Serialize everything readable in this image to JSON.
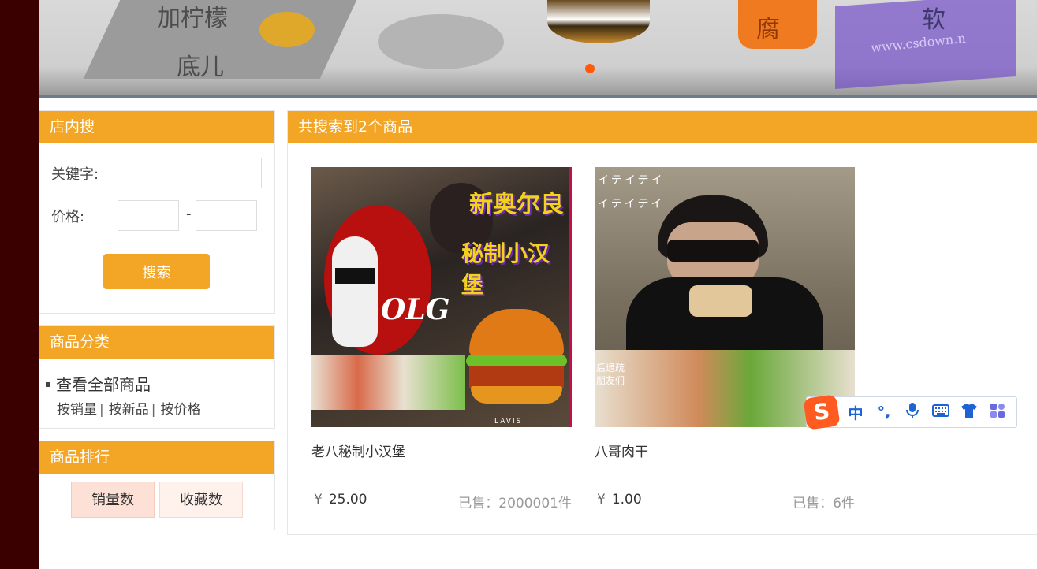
{
  "banner": {
    "texts": [
      "加柠檬",
      "底儿",
      "腐",
      "软"
    ],
    "watermark": "www.csdown.n",
    "active_dot_color": "#ff5a0d"
  },
  "search_panel": {
    "title": "店内搜",
    "keyword_label": "关键字:",
    "keyword_value": "",
    "price_label": "价格:",
    "price_min_value": "",
    "price_max_value": "",
    "price_separator": "-",
    "search_button": "搜索"
  },
  "category_panel": {
    "title": "商品分类",
    "view_all": "查看全部商品",
    "sort_links": [
      "按销量",
      "按新品",
      "按价格"
    ],
    "separator": "|"
  },
  "ranking_panel": {
    "title": "商品排行",
    "buttons": [
      "销量数",
      "收藏数"
    ]
  },
  "results": {
    "title": "共搜索到2个商品",
    "products": [
      {
        "name": "老八秘制小汉堡",
        "price": "25.00",
        "currency": "¥",
        "sold": "已售：2000001件",
        "image_texts": [
          "新奥尔良",
          "秘制小汉堡",
          "OLG",
          "LAVIS"
        ]
      },
      {
        "name": "八哥肉干",
        "price": "1.00",
        "currency": "¥",
        "sold": "已售：6件",
        "image_texts": [
          "イテイテイ",
          "后退疏",
          "朋友们"
        ]
      }
    ]
  },
  "ime_toolbar": {
    "logo": "S",
    "items": [
      "中",
      "°,",
      "mic-icon",
      "keyboard-icon",
      "shirt-icon",
      "apps-icon"
    ],
    "chinese_label": "中",
    "punct_label": "°,"
  },
  "colors": {
    "accent": "#f3a526",
    "left_strip": "#3a0000",
    "ime_logo": "#ff5a1f",
    "ime_icon": "#1e63d4"
  }
}
